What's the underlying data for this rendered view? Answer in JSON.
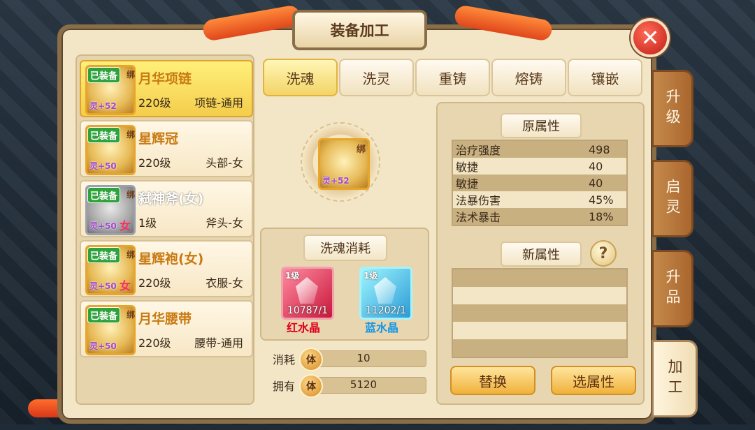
{
  "window": {
    "title": "装备加工",
    "close_symbol": "✕"
  },
  "side_tabs": [
    {
      "label": "升级",
      "active": false
    },
    {
      "label": "启灵",
      "active": false
    },
    {
      "label": "升品",
      "active": false
    },
    {
      "label": "加工",
      "active": true
    }
  ],
  "equipment_list": [
    {
      "badge": "已装备",
      "bind": "绑",
      "name": "月华项链",
      "level": "220级",
      "type": "项链-通用",
      "spirit": "灵+52",
      "selected": true
    },
    {
      "badge": "已装备",
      "bind": "绑",
      "name": "星辉冠",
      "level": "220级",
      "type": "头部-女",
      "spirit": "灵+50",
      "selected": false
    },
    {
      "badge": "已装备",
      "bind": "绑",
      "name": "弑神斧(女)",
      "level": "1级",
      "type": "斧头-女",
      "spirit": "灵+50",
      "female": "女",
      "selected": false
    },
    {
      "badge": "已装备",
      "bind": "绑",
      "name": "星辉袍(女)",
      "level": "220级",
      "type": "衣服-女",
      "spirit": "灵+50",
      "female": "女",
      "selected": false
    },
    {
      "badge": "已装备",
      "bind": "绑",
      "name": "月华腰带",
      "level": "220级",
      "type": "腰带-通用",
      "spirit": "灵+50",
      "selected": false
    }
  ],
  "tabs": [
    {
      "label": "洗魂",
      "active": true
    },
    {
      "label": "洗灵",
      "active": false
    },
    {
      "label": "重铸",
      "active": false
    },
    {
      "label": "熔铸",
      "active": false
    },
    {
      "label": "镶嵌",
      "active": false
    }
  ],
  "selected_item": {
    "bind": "绑",
    "spirit": "灵+52"
  },
  "cost": {
    "title": "洗魂消耗",
    "materials": [
      {
        "level": "1级",
        "count": "10787/1",
        "name": "红水晶",
        "color": "#e0001b"
      },
      {
        "level": "1级",
        "count": "11202/1",
        "name": "蓝水晶",
        "color": "#1196e8"
      }
    ],
    "consume_label": "消耗",
    "consume_icon": "体",
    "consume_value": "10",
    "own_label": "拥有",
    "own_icon": "体",
    "own_value": "5120"
  },
  "original_attrs": {
    "title": "原属性",
    "rows": [
      {
        "name": "治疗强度",
        "value": "498"
      },
      {
        "name": "敏捷",
        "value": "40"
      },
      {
        "name": "敏捷",
        "value": "40"
      },
      {
        "name": "法暴伤害",
        "value": "45%"
      },
      {
        "name": "法术暴击",
        "value": "18%"
      }
    ]
  },
  "new_attrs": {
    "title": "新属性",
    "help": "?"
  },
  "buttons": {
    "replace": "替换",
    "select_attr": "选属性"
  }
}
